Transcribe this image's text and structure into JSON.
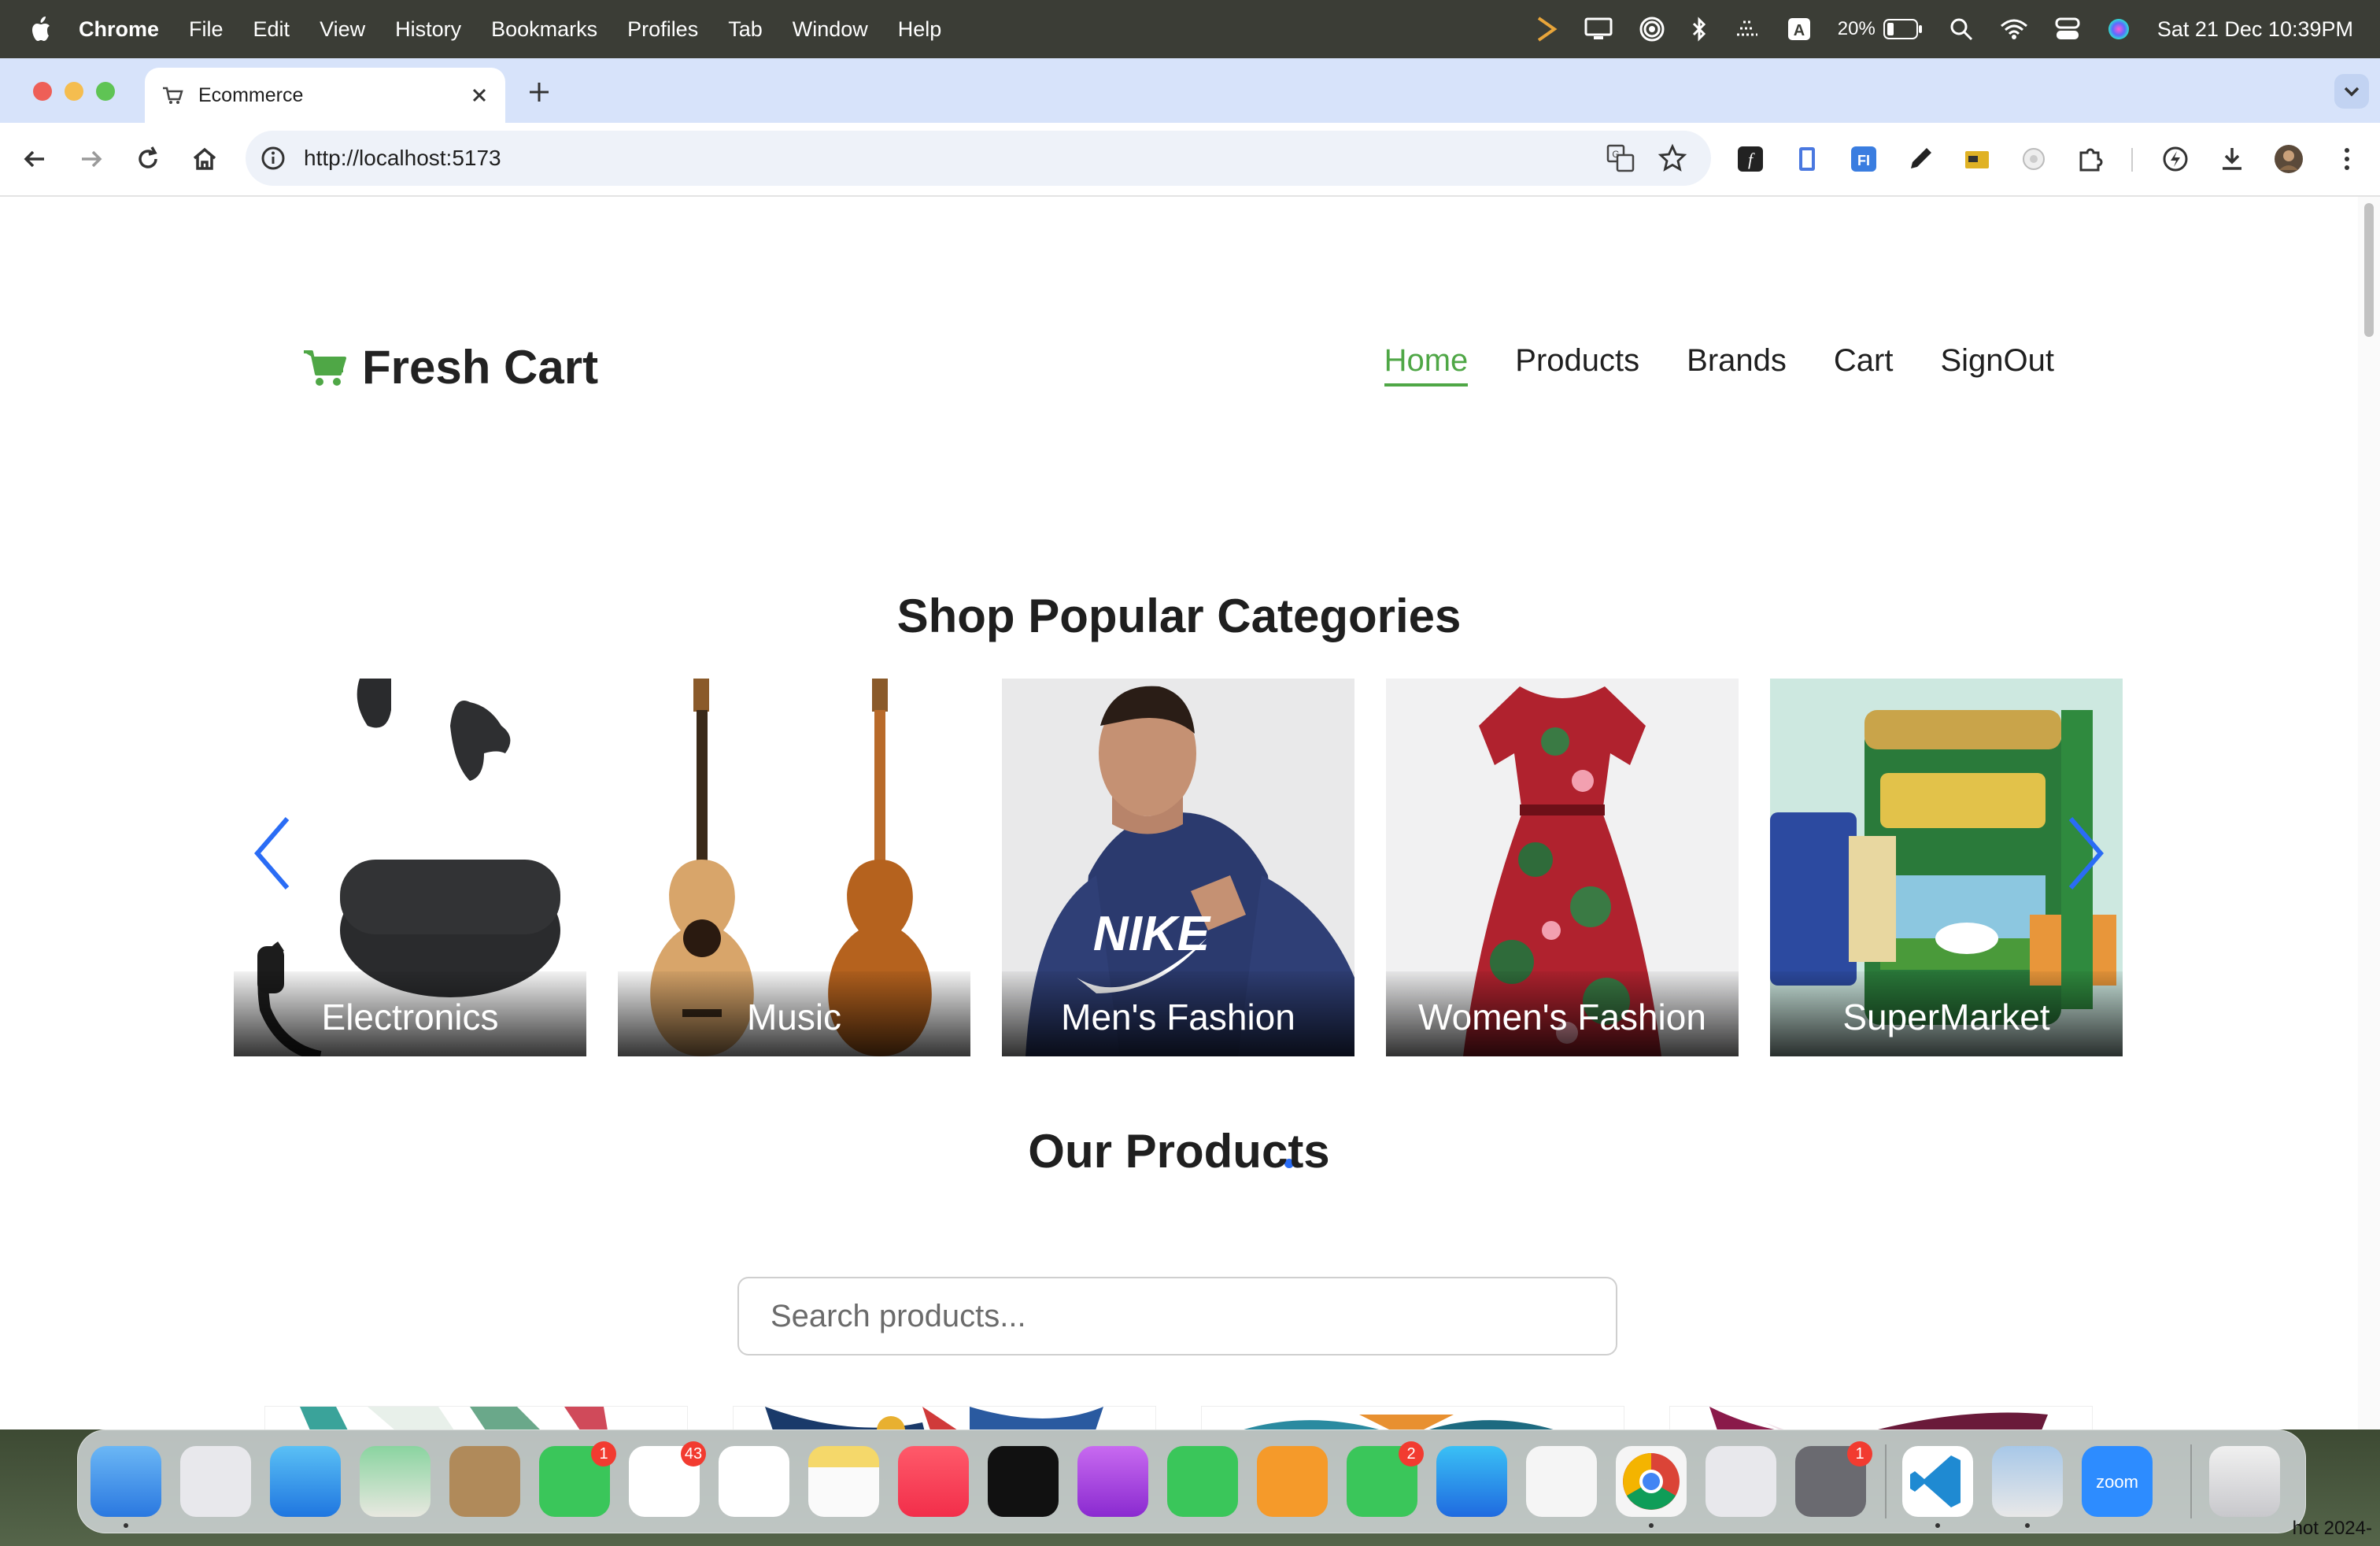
{
  "menubar": {
    "app_name": "Chrome",
    "menus": [
      "File",
      "Edit",
      "View",
      "History",
      "Bookmarks",
      "Profiles",
      "Tab",
      "Window",
      "Help"
    ],
    "battery_percent": "20%",
    "keyboard_input": "A",
    "datetime": "Sat 21 Dec  10:39PM"
  },
  "browser": {
    "tab_title": "Ecommerce",
    "url": "http://localhost:5173"
  },
  "site": {
    "brand": "Fresh Cart",
    "nav": [
      "Home",
      "Products",
      "Brands",
      "Cart",
      "SignOut"
    ],
    "active_nav": "Home",
    "accent_color": "#4fa746",
    "categories_heading": "Shop Popular Categories",
    "categories": [
      "Electronics",
      "Music",
      "Men's Fashion",
      "Women's Fashion",
      "SuperMarket"
    ],
    "products_heading": "Our Products",
    "search_placeholder": "Search products..."
  },
  "dock": {
    "apps": [
      "Finder",
      "Launchpad",
      "Mail",
      "Maps",
      "Contacts",
      "FaceTime",
      "Reminders",
      "Freeform",
      "Notes",
      "Music",
      "TV",
      "Podcasts",
      "Numbers",
      "Pages",
      "Messages",
      "App Store",
      "Safari",
      "Chrome",
      "iPhone Mirroring",
      "System Settings",
      "Visual Studio Code",
      "Preview",
      "Zoom",
      "Trash"
    ],
    "badges": {
      "FaceTime": "1",
      "Reminders": "43",
      "Messages": "2",
      "System Settings": "1"
    },
    "desktop_caption": "hot 2024-"
  }
}
